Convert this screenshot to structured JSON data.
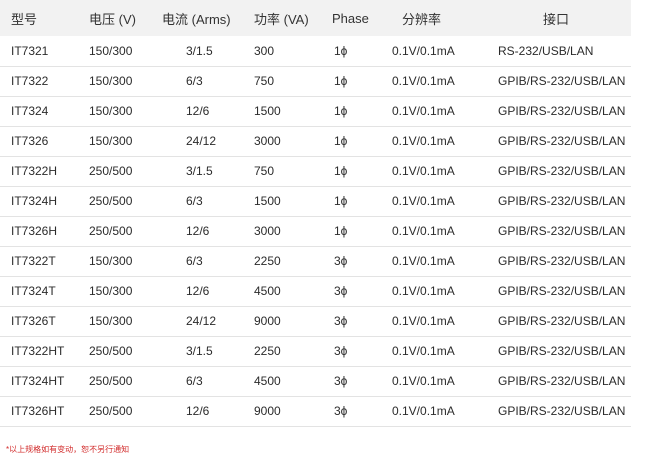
{
  "headers": {
    "model": "型号",
    "voltage": "电压 (V)",
    "current": "电流 (Arms)",
    "power": "功率 (VA)",
    "phase": "Phase",
    "resolution": "分辨率",
    "interface": "接口"
  },
  "rows": [
    {
      "model": "IT7321",
      "voltage": "150/300",
      "current": "3/1.5",
      "power": "300",
      "phase": "1ϕ",
      "resolution": "0.1V/0.1mA",
      "interface": "RS-232/USB/LAN"
    },
    {
      "model": "IT7322",
      "voltage": "150/300",
      "current": "6/3",
      "power": "750",
      "phase": "1ϕ",
      "resolution": "0.1V/0.1mA",
      "interface": "GPIB/RS-232/USB/LAN"
    },
    {
      "model": "IT7324",
      "voltage": "150/300",
      "current": "12/6",
      "power": "1500",
      "phase": "1ϕ",
      "resolution": "0.1V/0.1mA",
      "interface": "GPIB/RS-232/USB/LAN"
    },
    {
      "model": "IT7326",
      "voltage": "150/300",
      "current": "24/12",
      "power": "3000",
      "phase": "1ϕ",
      "resolution": "0.1V/0.1mA",
      "interface": "GPIB/RS-232/USB/LAN"
    },
    {
      "model": "IT7322H",
      "voltage": "250/500",
      "current": "3/1.5",
      "power": "750",
      "phase": "1ϕ",
      "resolution": "0.1V/0.1mA",
      "interface": "GPIB/RS-232/USB/LAN"
    },
    {
      "model": "IT7324H",
      "voltage": "250/500",
      "current": "6/3",
      "power": "1500",
      "phase": "1ϕ",
      "resolution": "0.1V/0.1mA",
      "interface": "GPIB/RS-232/USB/LAN"
    },
    {
      "model": "IT7326H",
      "voltage": "250/500",
      "current": "12/6",
      "power": "3000",
      "phase": "1ϕ",
      "resolution": "0.1V/0.1mA",
      "interface": "GPIB/RS-232/USB/LAN"
    },
    {
      "model": "IT7322T",
      "voltage": "150/300",
      "current": "6/3",
      "power": "2250",
      "phase": "3ϕ",
      "resolution": "0.1V/0.1mA",
      "interface": "GPIB/RS-232/USB/LAN"
    },
    {
      "model": "IT7324T",
      "voltage": "150/300",
      "current": "12/6",
      "power": "4500",
      "phase": "3ϕ",
      "resolution": "0.1V/0.1mA",
      "interface": "GPIB/RS-232/USB/LAN"
    },
    {
      "model": "IT7326T",
      "voltage": "150/300",
      "current": "24/12",
      "power": "9000",
      "phase": "3ϕ",
      "resolution": "0.1V/0.1mA",
      "interface": "GPIB/RS-232/USB/LAN"
    },
    {
      "model": "IT7322HT",
      "voltage": "250/500",
      "current": "3/1.5",
      "power": "2250",
      "phase": "3ϕ",
      "resolution": "0.1V/0.1mA",
      "interface": "GPIB/RS-232/USB/LAN"
    },
    {
      "model": "IT7324HT",
      "voltage": "250/500",
      "current": "6/3",
      "power": "4500",
      "phase": "3ϕ",
      "resolution": "0.1V/0.1mA",
      "interface": "GPIB/RS-232/USB/LAN"
    },
    {
      "model": "IT7326HT",
      "voltage": "250/500",
      "current": "12/6",
      "power": "9000",
      "phase": "3ϕ",
      "resolution": "0.1V/0.1mA",
      "interface": "GPIB/RS-232/USB/LAN"
    }
  ],
  "footnote": "*以上规格如有变动，恕不另行通知",
  "colors": {
    "header_bg": "#f2f2f2",
    "footnote": "#d22b2b",
    "row_divider": "#e3e3e3"
  }
}
